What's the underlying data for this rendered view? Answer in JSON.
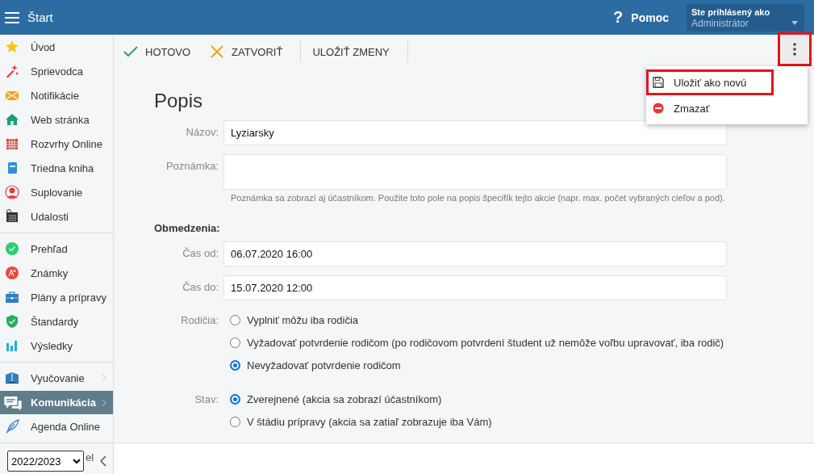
{
  "header": {
    "title": "Štart",
    "help_mark": "?",
    "help_label": "Pomoc",
    "user": {
      "caption": "Ste prihlásený ako",
      "name": "Administrátor"
    }
  },
  "sidebar": {
    "groups": [
      {
        "items": [
          {
            "label": "Úvod",
            "selected": false,
            "has_submenu": false
          },
          {
            "label": "Sprievodca",
            "selected": false,
            "has_submenu": false
          },
          {
            "label": "Notifikácie",
            "selected": false,
            "has_submenu": false
          },
          {
            "label": "Web stránka",
            "selected": false,
            "has_submenu": false
          },
          {
            "label": "Rozvrhy Online",
            "selected": false,
            "has_submenu": false
          },
          {
            "label": "Triedna kniha",
            "selected": false,
            "has_submenu": false
          },
          {
            "label": "Suplovanie",
            "selected": false,
            "has_submenu": false
          },
          {
            "label": "Udalosti",
            "selected": false,
            "has_submenu": false
          }
        ]
      },
      {
        "items": [
          {
            "label": "Prehľad",
            "selected": false,
            "has_submenu": false
          },
          {
            "label": "Známky",
            "selected": false,
            "has_submenu": false
          },
          {
            "label": "Plány a prípravy",
            "selected": false,
            "has_submenu": false
          },
          {
            "label": "Štandardy",
            "selected": false,
            "has_submenu": false
          },
          {
            "label": "Výsledky",
            "selected": false,
            "has_submenu": false
          }
        ]
      },
      {
        "items": [
          {
            "label": "Vyučovanie",
            "selected": false,
            "has_submenu": true
          },
          {
            "label": "Komunikácia",
            "selected": true,
            "has_submenu": true
          },
          {
            "label": "Agenda Online",
            "selected": false,
            "has_submenu": false
          }
        ]
      }
    ],
    "covered_item_fragment": "el",
    "year_select": {
      "value": "2022/2023"
    }
  },
  "toolbar": {
    "buttons": [
      {
        "kind": "done",
        "label": "HOTOVO"
      },
      {
        "kind": "close",
        "label": "ZATVORIŤ"
      },
      {
        "kind": "save",
        "label": "ULOŽIŤ ZMENY"
      }
    ],
    "more_button": {
      "highlighted": true
    }
  },
  "menu": {
    "items": [
      {
        "kind": "save",
        "label": "Uložiť ako novú",
        "highlighted": true
      },
      {
        "kind": "delete",
        "label": "Zmazať",
        "highlighted": false
      }
    ]
  },
  "form": {
    "title": "Popis",
    "name": {
      "label": "Názov:",
      "value": "Lyziarsky"
    },
    "note": {
      "label": "Poznámka:",
      "hint": "Poznámka sa zobrazí aj účastníkom. Použite toto pole na popis špecifík tejto akcie (napr. max. počet vybraných cieľov a pod)."
    },
    "restrictions_heading": "Obmedzenia:",
    "time_from": {
      "label": "Čas od:",
      "value": "06.07.2020 16:00"
    },
    "time_to": {
      "label": "Čas do:",
      "value": "15.07.2020 12:00"
    },
    "radio_groups": [
      {
        "label": "Rodičia:",
        "options": [
          {
            "label": "Vyplniť môžu iba rodičia",
            "selected": false
          },
          {
            "label": "Vyžadovať potvrdenie rodičom (po rodičovom potvrdení študent už nemôže voľbu upravovať, iba rodič)",
            "selected": false
          },
          {
            "label": "Nevyžadovať potvrdenie rodičom",
            "selected": true
          }
        ]
      },
      {
        "label": "Stav:",
        "options": [
          {
            "label": "Zverejnené (akcia sa zobrazí účastníkom)",
            "selected": true
          },
          {
            "label": "V štádiu prípravy (akcia sa zatiaľ zobrazuje iba Vám)",
            "selected": false
          }
        ]
      }
    ]
  }
}
